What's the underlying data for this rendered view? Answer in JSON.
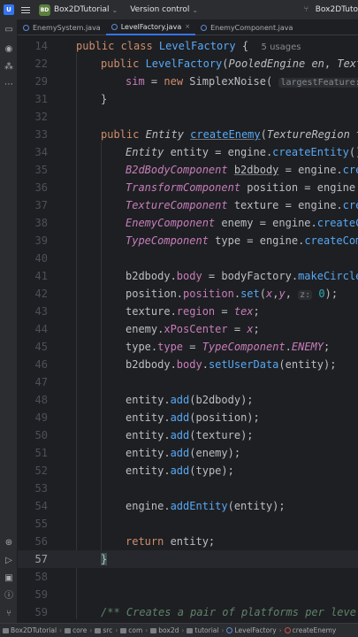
{
  "titlebar": {
    "logo_letter": "U",
    "project_badge": "BD",
    "project_name": "Box2DTutorial",
    "version_control": "Version control",
    "right_project": "Box2DTuto"
  },
  "tabs": [
    {
      "label": "EnemySystem.java",
      "active": false
    },
    {
      "label": "LevelFactory.java",
      "active": true
    },
    {
      "label": "EnemyComponent.java",
      "active": false
    }
  ],
  "tab_close": "×",
  "editor": {
    "usages": "5 usages",
    "hint_largest_feature": "largestFeature:",
    "hint_z": "z:",
    "lines": [
      {
        "n": "14"
      },
      {
        "n": "22"
      },
      {
        "n": "29"
      },
      {
        "n": "31"
      },
      {
        "n": "32"
      },
      {
        "n": "33"
      },
      {
        "n": "34"
      },
      {
        "n": "35"
      },
      {
        "n": "36"
      },
      {
        "n": "37"
      },
      {
        "n": "38"
      },
      {
        "n": "39"
      },
      {
        "n": "40"
      },
      {
        "n": "41"
      },
      {
        "n": "42"
      },
      {
        "n": "43"
      },
      {
        "n": "44"
      },
      {
        "n": "45"
      },
      {
        "n": "46"
      },
      {
        "n": "47"
      },
      {
        "n": "48"
      },
      {
        "n": "49"
      },
      {
        "n": "50"
      },
      {
        "n": "51"
      },
      {
        "n": "52"
      },
      {
        "n": "53"
      },
      {
        "n": "54"
      },
      {
        "n": "55"
      },
      {
        "n": "56"
      },
      {
        "n": "57"
      },
      {
        "n": "58"
      },
      {
        "n": "59"
      }
    ],
    "current_line": "56"
  },
  "breadcrumb": [
    "Box2DTutorial",
    "core",
    "src",
    "com",
    "box2d",
    "tutorial",
    "LevelFactory",
    "createEnemy"
  ]
}
